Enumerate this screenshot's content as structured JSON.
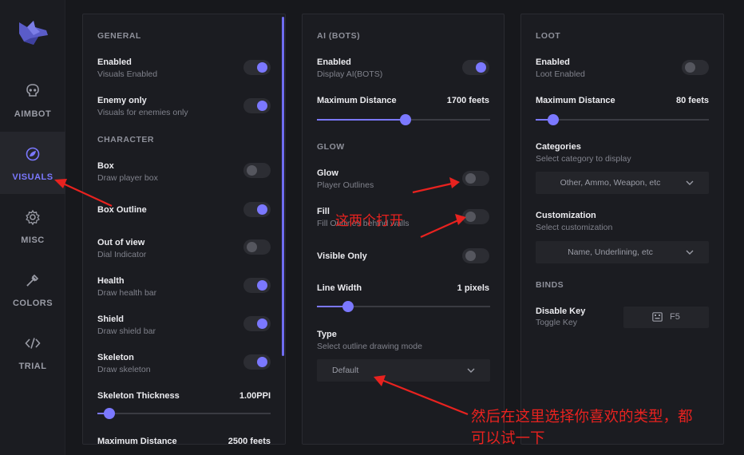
{
  "sidebar": {
    "items": [
      {
        "label": "AIMBOT",
        "icon": "skull-icon"
      },
      {
        "label": "VISUALS",
        "icon": "eye-icon",
        "active": true
      },
      {
        "label": "MISC",
        "icon": "gear-icon"
      },
      {
        "label": "COLORS",
        "icon": "eyedropper-icon"
      },
      {
        "label": "TRIAL",
        "icon": "code-icon"
      }
    ]
  },
  "general": {
    "section_general": "GENERAL",
    "enabled": {
      "label": "Enabled",
      "sub": "Visuals Enabled",
      "on": true
    },
    "enemy_only": {
      "label": "Enemy only",
      "sub": "Visuals for enemies only",
      "on": true
    },
    "section_character": "CHARACTER",
    "box": {
      "label": "Box",
      "sub": "Draw player box",
      "on": false
    },
    "box_outline": {
      "label": "Box Outline",
      "on": true
    },
    "out_of_view": {
      "label": "Out of view",
      "sub": "Dial Indicator",
      "on": false
    },
    "health": {
      "label": "Health",
      "sub": "Draw health bar",
      "on": true
    },
    "shield": {
      "label": "Shield",
      "sub": "Draw shield bar",
      "on": true
    },
    "skeleton": {
      "label": "Skeleton",
      "sub": "Draw skeleton",
      "on": true
    },
    "skeleton_thickness": {
      "label": "Skeleton Thickness",
      "value": "1.00PPI",
      "fraction": 0.07
    },
    "max_distance": {
      "label": "Maximum Distance",
      "value": "2500 feets"
    }
  },
  "ai": {
    "section_ai": "AI (BOTS)",
    "enabled": {
      "label": "Enabled",
      "sub": "Display AI(BOTS)",
      "on": true
    },
    "max_distance": {
      "label": "Maximum Distance",
      "value": "1700 feets",
      "fraction": 0.51
    },
    "section_glow": "GLOW",
    "glow": {
      "label": "Glow",
      "sub": "Player Outlines",
      "on": false
    },
    "fill": {
      "label": "Fill",
      "sub": "Fill Outlines behind walls",
      "on": false
    },
    "visible_only": {
      "label": "Visible Only",
      "on": false
    },
    "line_width": {
      "label": "Line Width",
      "value": "1 pixels",
      "fraction": 0.18
    },
    "type": {
      "label": "Type",
      "sub": "Select outline drawing mode",
      "selected": "Default"
    }
  },
  "loot": {
    "section_loot": "LOOT",
    "enabled": {
      "label": "Enabled",
      "sub": "Loot Enabled",
      "on": false
    },
    "max_distance": {
      "label": "Maximum Distance",
      "value": "80 feets",
      "fraction": 0.1
    },
    "categories": {
      "label": "Categories",
      "sub": "Select category to display",
      "selected": "Other, Ammo, Weapon, etc"
    },
    "customization": {
      "label": "Customization",
      "sub": "Select customization",
      "selected": "Name, Underlining, etc"
    },
    "section_binds": "BINDS",
    "disable_key": {
      "label": "Disable Key",
      "sub": "Toggle Key",
      "key": "F5"
    }
  },
  "annotations": {
    "open_both": "这两个打开",
    "choose_type_line1": "然后在这里选择你喜欢的类型，都",
    "choose_type_line2": "可以试一下",
    "color": "#e8221f"
  },
  "colors": {
    "accent": "#7b78ff",
    "panel": "#1b1c21",
    "background": "#17181c"
  }
}
